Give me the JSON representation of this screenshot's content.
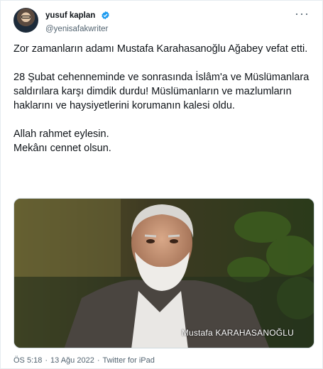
{
  "author": {
    "display_name": "yusuf kaplan",
    "handle": "@yenisafakwriter",
    "verified_color": "#1d9bf0"
  },
  "tweet": {
    "text": "Zor zamanların adamı Mustafa Karahasanoğlu Ağabey vefat etti.\n\n28 Şubat cehenneminde ve sonrasında İslâm'a ve Müslümanlara saldırılara karşı dimdik durdu! Müslümanların ve mazlumların  haklarını ve haysiyetlerini korumanın kalesi oldu.\n\nAllah rahmet eylesin.\nMekânı cennet olsun.",
    "media_caption": "Mustafa KARAHASANOĞLU"
  },
  "meta": {
    "time": "ÖS 5:18",
    "date": "13 Ağu 2022",
    "source": "Twitter for iPad"
  },
  "icons": {
    "more": "more-options-icon",
    "verified": "verified-badge-icon"
  }
}
